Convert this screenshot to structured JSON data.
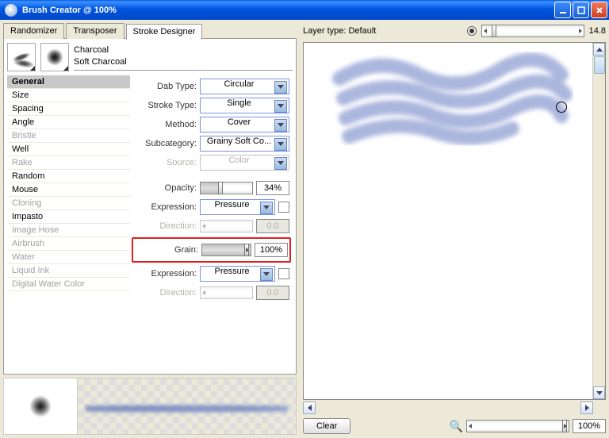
{
  "window": {
    "title": "Brush Creator @ 100%"
  },
  "tabs": {
    "randomizer": "Randomizer",
    "transposer": "Transposer",
    "stroke_designer": "Stroke Designer"
  },
  "brush": {
    "category": "Charcoal",
    "variant": "Soft Charcoal"
  },
  "categories": [
    {
      "label": "General",
      "state": "selected"
    },
    {
      "label": "Size",
      "state": "enabled"
    },
    {
      "label": "Spacing",
      "state": "enabled"
    },
    {
      "label": "Angle",
      "state": "enabled"
    },
    {
      "label": "Bristle",
      "state": "disabled"
    },
    {
      "label": "Well",
      "state": "enabled"
    },
    {
      "label": "Rake",
      "state": "disabled"
    },
    {
      "label": "Random",
      "state": "enabled"
    },
    {
      "label": "Mouse",
      "state": "enabled"
    },
    {
      "label": "Cloning",
      "state": "disabled"
    },
    {
      "label": "Impasto",
      "state": "enabled"
    },
    {
      "label": "Image Hose",
      "state": "disabled"
    },
    {
      "label": "Airbrush",
      "state": "disabled"
    },
    {
      "label": "Water",
      "state": "disabled"
    },
    {
      "label": "Liquid Ink",
      "state": "disabled"
    },
    {
      "label": "Digital Water Color",
      "state": "disabled"
    }
  ],
  "props": {
    "dab_type": {
      "label": "Dab Type:",
      "value": "Circular"
    },
    "stroke_type": {
      "label": "Stroke Type:",
      "value": "Single"
    },
    "method": {
      "label": "Method:",
      "value": "Cover"
    },
    "subcategory": {
      "label": "Subcategory:",
      "value": "Grainy Soft Co..."
    },
    "source": {
      "label": "Source:",
      "value": "Color"
    },
    "opacity": {
      "label": "Opacity:",
      "value": "34%",
      "pct": 34
    },
    "expression1": {
      "label": "Expression:",
      "value": "Pressure"
    },
    "direction1": {
      "label": "Direction:",
      "value": "0.0"
    },
    "grain": {
      "label": "Grain:",
      "value": "100%",
      "pct": 100
    },
    "expression2": {
      "label": "Expression:",
      "value": "Pressure"
    },
    "direction2": {
      "label": "Direction:",
      "value": "0.0"
    }
  },
  "layer": {
    "label": "Layer type: Default",
    "value": "14.8"
  },
  "zoom": {
    "value": "100%"
  },
  "buttons": {
    "clear": "Clear"
  }
}
